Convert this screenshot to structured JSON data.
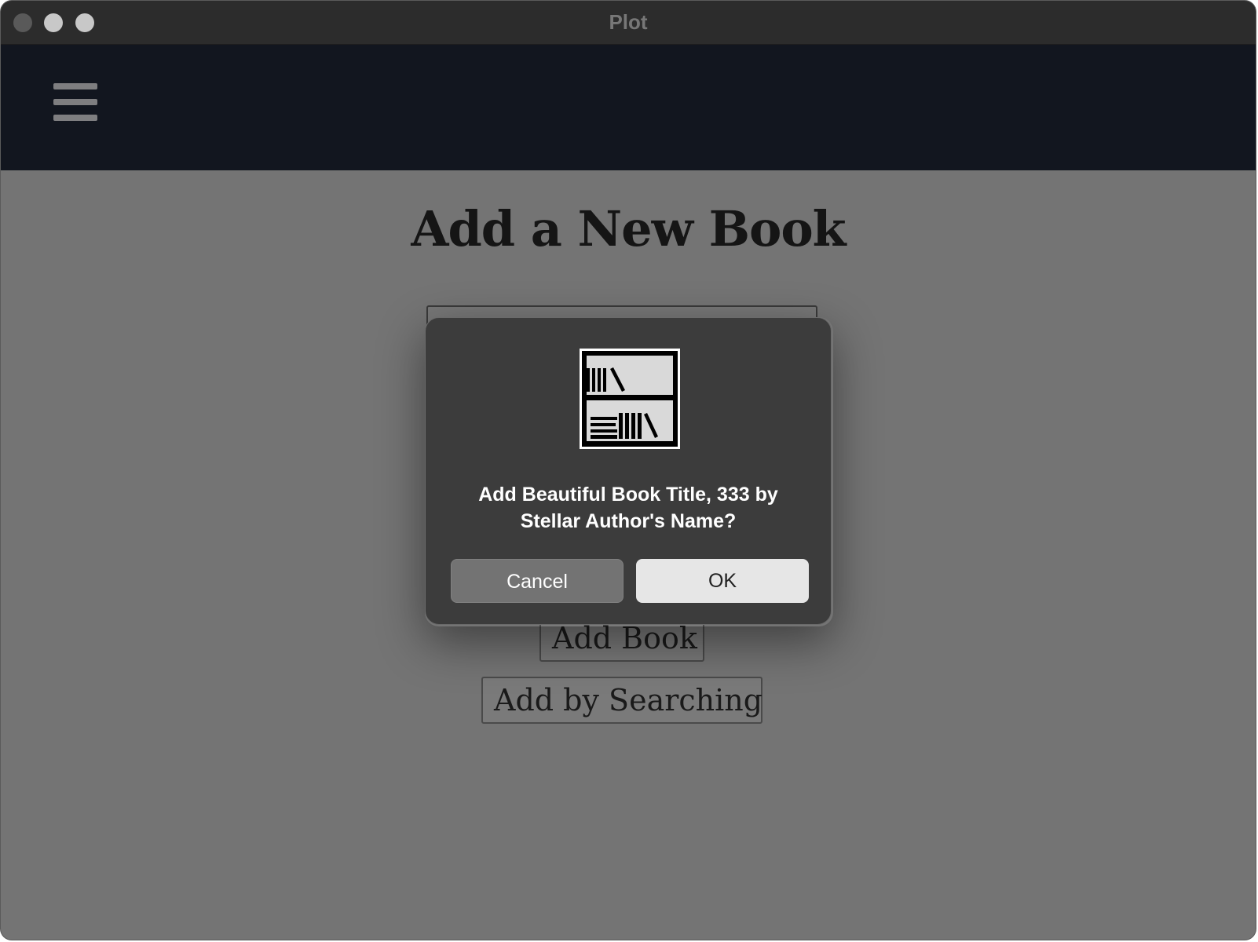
{
  "window": {
    "title": "Plot"
  },
  "page": {
    "heading": "Add a New Book",
    "buttons": {
      "add_book": "Add Book",
      "add_by_searching": "Add by Searching"
    }
  },
  "dialog": {
    "icon": "bookshelf-icon",
    "message_line1": "Add Beautiful Book Title, 333 by",
    "message_line2": "Stellar Author's Name?",
    "cancel_label": "Cancel",
    "ok_label": "OK"
  },
  "icons": {
    "menu": "hamburger-menu-icon"
  },
  "colors": {
    "navbar": "#12161f",
    "overlay_background": "#747474",
    "dialog_background": "#3c3c3c",
    "ok_button": "#e6e6e6",
    "cancel_button": "#737373"
  }
}
